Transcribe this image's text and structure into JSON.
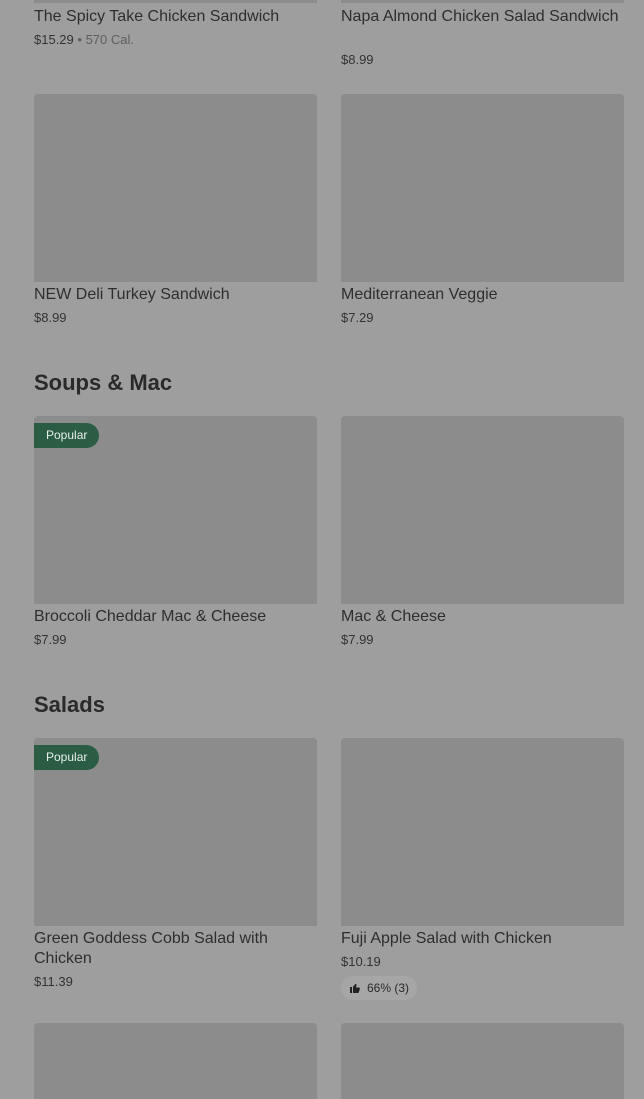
{
  "sections": {
    "soups": "Soups & Mac",
    "salads": "Salads"
  },
  "badges": {
    "popular": "Popular"
  },
  "items": {
    "spicy_take": {
      "name": "The Spicy Take Chicken Sandwich",
      "price": "$15.29",
      "separator": "•",
      "calories": "570 Cal."
    },
    "napa": {
      "name": "Napa Almond Chicken Salad Sandwich",
      "price": "$8.99"
    },
    "deli_turkey": {
      "name": "NEW Deli Turkey Sandwich",
      "price": "$8.99"
    },
    "mediterranean": {
      "name": "Mediterranean Veggie",
      "price": "$7.29"
    },
    "broccoli_mac": {
      "name": "Broccoli Cheddar Mac & Cheese",
      "price": "$7.99"
    },
    "mac_cheese": {
      "name": "Mac & Cheese",
      "price": "$7.99"
    },
    "green_goddess": {
      "name": "Green Goddess Cobb Salad with Chicken",
      "price": "$11.39"
    },
    "fuji_apple": {
      "name": "Fuji Apple Salad with Chicken",
      "price": "$10.19",
      "rating": "66% (3)"
    }
  },
  "icons": {
    "rating": "thumbs-up-icon"
  }
}
